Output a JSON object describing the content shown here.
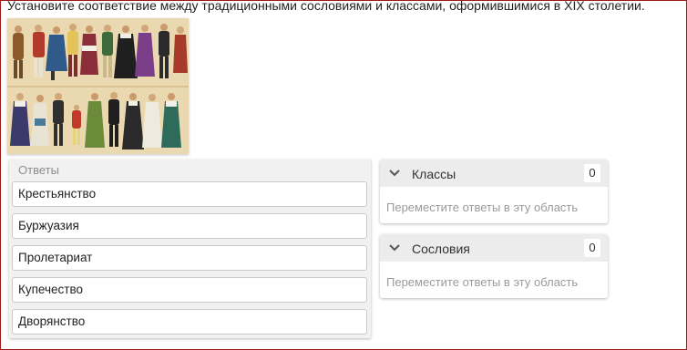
{
  "question": {
    "text": "Установите соответствие между традиционными сословиями и классами, оформившимися в XIX столетии."
  },
  "answers": {
    "title": "Ответы",
    "items": [
      {
        "label": "Крестьянство"
      },
      {
        "label": "Буржуазия"
      },
      {
        "label": "Пролетариат"
      },
      {
        "label": "Купечество"
      },
      {
        "label": "Дворянство"
      }
    ]
  },
  "groups": [
    {
      "label": "Классы",
      "count": "0",
      "hint": "Переместите ответы в эту область"
    },
    {
      "label": "Сословия",
      "count": "0",
      "hint": "Переместите ответы в эту область"
    }
  ],
  "colors": {
    "frame_border": "#9b1b1b",
    "panel_bg": "#f1f1f1",
    "hint_text": "#9a9a9a"
  }
}
